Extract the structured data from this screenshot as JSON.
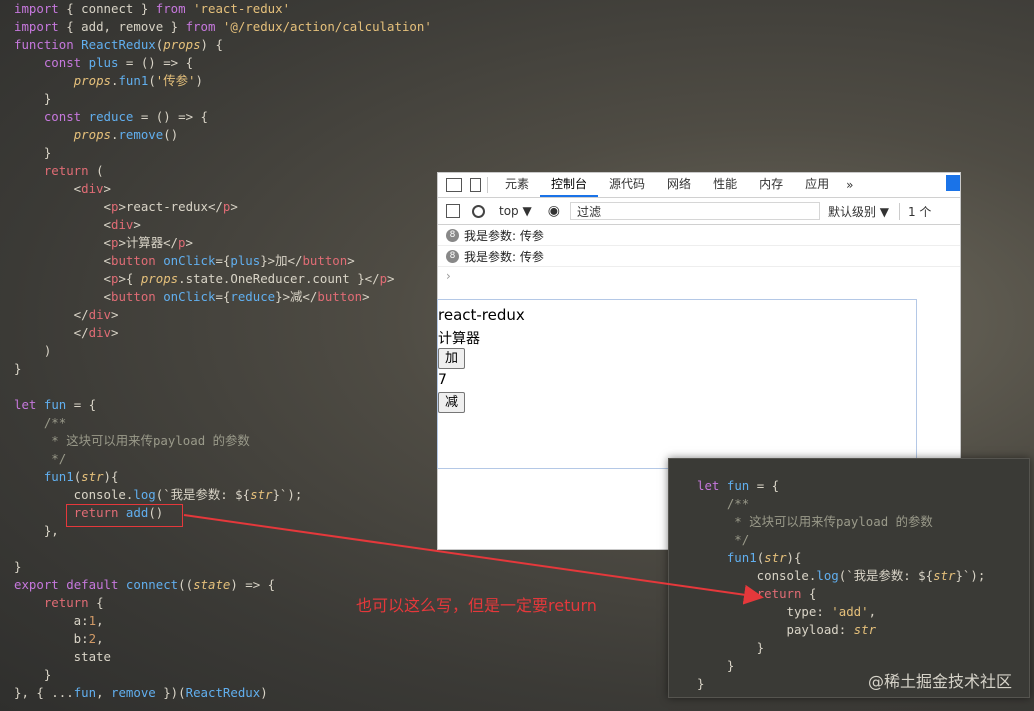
{
  "code_main": [
    [
      [
        "kw",
        "import"
      ],
      [
        "t",
        " { connect } "
      ],
      [
        "kw",
        "from"
      ],
      [
        "t",
        " "
      ],
      [
        "str",
        "'react-redux'"
      ]
    ],
    [
      [
        "kw",
        "import"
      ],
      [
        "t",
        " { add, remove } "
      ],
      [
        "kw",
        "from"
      ],
      [
        "t",
        " "
      ],
      [
        "str",
        "'@/redux/action/calculation'"
      ]
    ],
    [
      [
        "kw",
        "function"
      ],
      [
        "t",
        " "
      ],
      [
        "fn",
        "ReactRedux"
      ],
      [
        "t",
        "("
      ],
      [
        "ital",
        "props"
      ],
      [
        "t",
        ") {"
      ]
    ],
    [
      [
        "t",
        "    "
      ],
      [
        "kw",
        "const"
      ],
      [
        "t",
        " "
      ],
      [
        "fn",
        "plus"
      ],
      [
        "t",
        " = () => {"
      ]
    ],
    [
      [
        "t",
        "        "
      ],
      [
        "ital",
        "props"
      ],
      [
        "t",
        "."
      ],
      [
        "fn",
        "fun1"
      ],
      [
        "t",
        "("
      ],
      [
        "str",
        "'传参'"
      ],
      [
        "t",
        ")"
      ]
    ],
    [
      [
        "t",
        "    }"
      ]
    ],
    [
      [
        "t",
        "    "
      ],
      [
        "kw",
        "const"
      ],
      [
        "t",
        " "
      ],
      [
        "fn",
        "reduce"
      ],
      [
        "t",
        " = () => {"
      ]
    ],
    [
      [
        "t",
        "        "
      ],
      [
        "ital",
        "props"
      ],
      [
        "t",
        "."
      ],
      [
        "fn",
        "remove"
      ],
      [
        "t",
        "()"
      ]
    ],
    [
      [
        "t",
        "    }"
      ]
    ],
    [
      [
        "t",
        "    "
      ],
      [
        "kw2",
        "return"
      ],
      [
        "t",
        " ("
      ]
    ],
    [
      [
        "t",
        "        <"
      ],
      [
        "tag",
        "div"
      ],
      [
        "t",
        ">"
      ]
    ],
    [
      [
        "t",
        "            <"
      ],
      [
        "tag",
        "p"
      ],
      [
        "t",
        ">react-redux</"
      ],
      [
        "tag",
        "p"
      ],
      [
        "t",
        ">"
      ]
    ],
    [
      [
        "t",
        "            <"
      ],
      [
        "tag",
        "div"
      ],
      [
        "t",
        ">"
      ]
    ],
    [
      [
        "t",
        "            <"
      ],
      [
        "tag",
        "p"
      ],
      [
        "t",
        ">计算器</"
      ],
      [
        "tag",
        "p"
      ],
      [
        "t",
        ">"
      ]
    ],
    [
      [
        "t",
        "            <"
      ],
      [
        "tag",
        "button"
      ],
      [
        "t",
        " "
      ],
      [
        "fn",
        "onClick"
      ],
      [
        "t",
        "={"
      ],
      [
        "fn",
        "plus"
      ],
      [
        "t",
        "}>加</"
      ],
      [
        "tag",
        "button"
      ],
      [
        "t",
        ">"
      ]
    ],
    [
      [
        "t",
        "            <"
      ],
      [
        "tag",
        "p"
      ],
      [
        "t",
        ">{ "
      ],
      [
        "ital",
        "props"
      ],
      [
        "t",
        ".state.OneReducer.count }</"
      ],
      [
        "tag",
        "p"
      ],
      [
        "t",
        ">"
      ]
    ],
    [
      [
        "t",
        "            <"
      ],
      [
        "tag",
        "button"
      ],
      [
        "t",
        " "
      ],
      [
        "fn",
        "onClick"
      ],
      [
        "t",
        "={"
      ],
      [
        "fn",
        "reduce"
      ],
      [
        "t",
        "}>减</"
      ],
      [
        "tag",
        "button"
      ],
      [
        "t",
        ">"
      ]
    ],
    [
      [
        "t",
        "        </"
      ],
      [
        "tag",
        "div"
      ],
      [
        "t",
        ">"
      ]
    ],
    [
      [
        "t",
        "        </"
      ],
      [
        "tag",
        "div"
      ],
      [
        "t",
        ">"
      ]
    ],
    [
      [
        "t",
        "    )"
      ]
    ],
    [
      [
        "t",
        "}"
      ]
    ],
    [
      [
        "t",
        ""
      ]
    ],
    [
      [
        "kw",
        "let"
      ],
      [
        "t",
        " "
      ],
      [
        "fn",
        "fun"
      ],
      [
        "t",
        " = {"
      ]
    ],
    [
      [
        "t",
        "    "
      ],
      [
        "cm",
        "/**"
      ]
    ],
    [
      [
        "t",
        "    "
      ],
      [
        "cm",
        " * 这块可以用来传payload 的参数"
      ]
    ],
    [
      [
        "t",
        "    "
      ],
      [
        "cm",
        " */"
      ]
    ],
    [
      [
        "t",
        "    "
      ],
      [
        "fn",
        "fun1"
      ],
      [
        "t",
        "("
      ],
      [
        "ital",
        "str"
      ],
      [
        "t",
        "){"
      ]
    ],
    [
      [
        "t",
        "        console."
      ],
      [
        "fn",
        "log"
      ],
      [
        "t",
        "(`我是参数: ${"
      ],
      [
        "ital",
        "str"
      ],
      [
        "t",
        "}`);"
      ]
    ],
    [
      [
        "t",
        "        "
      ],
      [
        "kw2",
        "return"
      ],
      [
        "t",
        " "
      ],
      [
        "fn",
        "add"
      ],
      [
        "t",
        "()"
      ]
    ],
    [
      [
        "t",
        "    },"
      ]
    ],
    [
      [
        "t",
        ""
      ]
    ],
    [
      [
        "t",
        "}"
      ]
    ],
    [
      [
        "kw",
        "export"
      ],
      [
        "t",
        " "
      ],
      [
        "kw",
        "default"
      ],
      [
        "t",
        " "
      ],
      [
        "fn",
        "connect"
      ],
      [
        "t",
        "(("
      ],
      [
        "ital",
        "state"
      ],
      [
        "t",
        ") => {"
      ]
    ],
    [
      [
        "t",
        "    "
      ],
      [
        "kw2",
        "return"
      ],
      [
        "t",
        " {"
      ]
    ],
    [
      [
        "t",
        "        a:"
      ],
      [
        "num",
        "1"
      ],
      [
        "t",
        ","
      ]
    ],
    [
      [
        "t",
        "        b:"
      ],
      [
        "num",
        "2"
      ],
      [
        "t",
        ","
      ]
    ],
    [
      [
        "t",
        "        state"
      ]
    ],
    [
      [
        "t",
        "    }"
      ]
    ],
    [
      [
        "t",
        "}, { ..."
      ],
      [
        "fn",
        "fun"
      ],
      [
        "t",
        ", "
      ],
      [
        "fn",
        "remove"
      ],
      [
        "t",
        " })("
      ],
      [
        "fn",
        "ReactRedux"
      ],
      [
        "t",
        ")"
      ]
    ]
  ],
  "code_zoom": [
    [
      [
        "kw",
        "let"
      ],
      [
        "t",
        " "
      ],
      [
        "fn",
        "fun"
      ],
      [
        "t",
        " = {"
      ]
    ],
    [
      [
        "t",
        "    "
      ],
      [
        "cm",
        "/**"
      ]
    ],
    [
      [
        "t",
        "    "
      ],
      [
        "cm",
        " * 这块可以用来传payload 的参数"
      ]
    ],
    [
      [
        "t",
        "    "
      ],
      [
        "cm",
        " */"
      ]
    ],
    [
      [
        "t",
        "    "
      ],
      [
        "fn",
        "fun1"
      ],
      [
        "t",
        "("
      ],
      [
        "ital",
        "str"
      ],
      [
        "t",
        "){"
      ]
    ],
    [
      [
        "t",
        "        console."
      ],
      [
        "fn",
        "log"
      ],
      [
        "t",
        "(`我是参数: ${"
      ],
      [
        "ital",
        "str"
      ],
      [
        "t",
        "}`);"
      ]
    ],
    [
      [
        "t",
        "        "
      ],
      [
        "kw2",
        "return"
      ],
      [
        "t",
        " {"
      ]
    ],
    [
      [
        "t",
        "            type: "
      ],
      [
        "str",
        "'add'"
      ],
      [
        "t",
        ","
      ]
    ],
    [
      [
        "t",
        "            payload: "
      ],
      [
        "ital",
        "str"
      ]
    ],
    [
      [
        "t",
        "        }"
      ]
    ],
    [
      [
        "t",
        "    }"
      ]
    ],
    [
      [
        "t",
        "}"
      ]
    ]
  ],
  "devtools": {
    "tabs": [
      "元素",
      "控制台",
      "源代码",
      "网络",
      "性能",
      "内存",
      "应用"
    ],
    "active_tab": "控制台",
    "more": "»",
    "context": "top ▼",
    "filter_placeholder": "过滤",
    "level": "默认级别 ▼",
    "issue_count": "1 个",
    "logs": [
      {
        "count": "8",
        "text": "我是参数: 传参"
      },
      {
        "count": "8",
        "text": "我是参数: 传参"
      }
    ],
    "prompt": "›"
  },
  "app": {
    "title": "react-redux",
    "subtitle": "计算器",
    "plus_label": "加",
    "count": "7",
    "minus_label": "减"
  },
  "annotation": "也可以这么写，但是一定要return",
  "watermark": "@稀土掘金技术社区",
  "colors": {
    "highlight": "#e5383b",
    "active_tab": "#1a73e8"
  }
}
